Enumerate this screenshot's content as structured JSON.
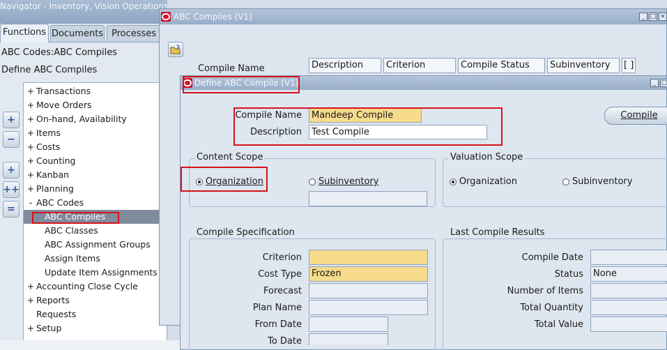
{
  "navigator": {
    "title": "Navigator - Inventory, Vision Operations (US",
    "tabs": [
      "Functions",
      "Documents",
      "Processes"
    ],
    "path": "ABC Codes:ABC Compiles",
    "heading": "Define ABC Compiles",
    "tree": [
      {
        "exp": "+",
        "label": "Transactions"
      },
      {
        "exp": "+",
        "label": "Move Orders"
      },
      {
        "exp": "+",
        "label": "On-hand, Availability"
      },
      {
        "exp": "+",
        "label": "Items"
      },
      {
        "exp": "+",
        "label": "Costs"
      },
      {
        "exp": "+",
        "label": "Counting"
      },
      {
        "exp": "+",
        "label": "Kanban"
      },
      {
        "exp": "+",
        "label": "Planning"
      },
      {
        "exp": "-",
        "label": "ABC Codes"
      },
      {
        "exp": "",
        "label": "ABC Compiles"
      },
      {
        "exp": "",
        "label": "ABC Classes"
      },
      {
        "exp": "",
        "label": "ABC Assignment Groups"
      },
      {
        "exp": "",
        "label": "Assign Items"
      },
      {
        "exp": "",
        "label": "Update Item Assignments"
      },
      {
        "exp": "+",
        "label": "Accounting Close Cycle"
      },
      {
        "exp": "+",
        "label": "Reports"
      },
      {
        "exp": "",
        "label": "Requests"
      },
      {
        "exp": "+",
        "label": "Setup"
      }
    ]
  },
  "abc_compiles": {
    "title": "ABC Compiles (V1)",
    "columns": {
      "compile_name": "Compile Name",
      "description": "Description",
      "criterion": "Criterion",
      "compile_status": "Compile Status",
      "subinventory": "Subinventory",
      "extra": "[ ]"
    }
  },
  "define": {
    "title": "Define ABC Compile (V1)",
    "compile_name_label": "Compile Name",
    "compile_name_value": "Mandeep Compile",
    "description_label": "Description",
    "description_value": "Test Compile",
    "compile_button": "Compile",
    "content_scope": {
      "title": "Content Scope",
      "organization": "Organization",
      "subinventory": "Subinventory"
    },
    "valuation_scope": {
      "title": "Valuation Scope",
      "organization": "Organization",
      "subinventory": "Subinventory"
    },
    "spec": {
      "title": "Compile Specification",
      "criterion_label": "Criterion",
      "criterion_value": "",
      "cost_type_label": "Cost Type",
      "cost_type_value": "Frozen",
      "forecast_label": "Forecast",
      "forecast_value": "",
      "plan_name_label": "Plan Name",
      "plan_name_value": "",
      "from_date_label": "From Date",
      "from_date_value": "",
      "to_date_label": "To Date"
    },
    "results": {
      "title": "Last Compile Results",
      "compile_date_label": "Compile Date",
      "compile_date_value": "",
      "status_label": "Status",
      "status_value": "None",
      "num_items_label": "Number of Items",
      "num_items_value": "",
      "total_qty_label": "Total Quantity",
      "total_qty_value": "",
      "total_value_label": "Total Value",
      "total_value_value": ""
    }
  },
  "colors": {
    "highlight": "#d8121b",
    "required": "#f6dc8c",
    "selected_row": "#7f8c9d"
  }
}
